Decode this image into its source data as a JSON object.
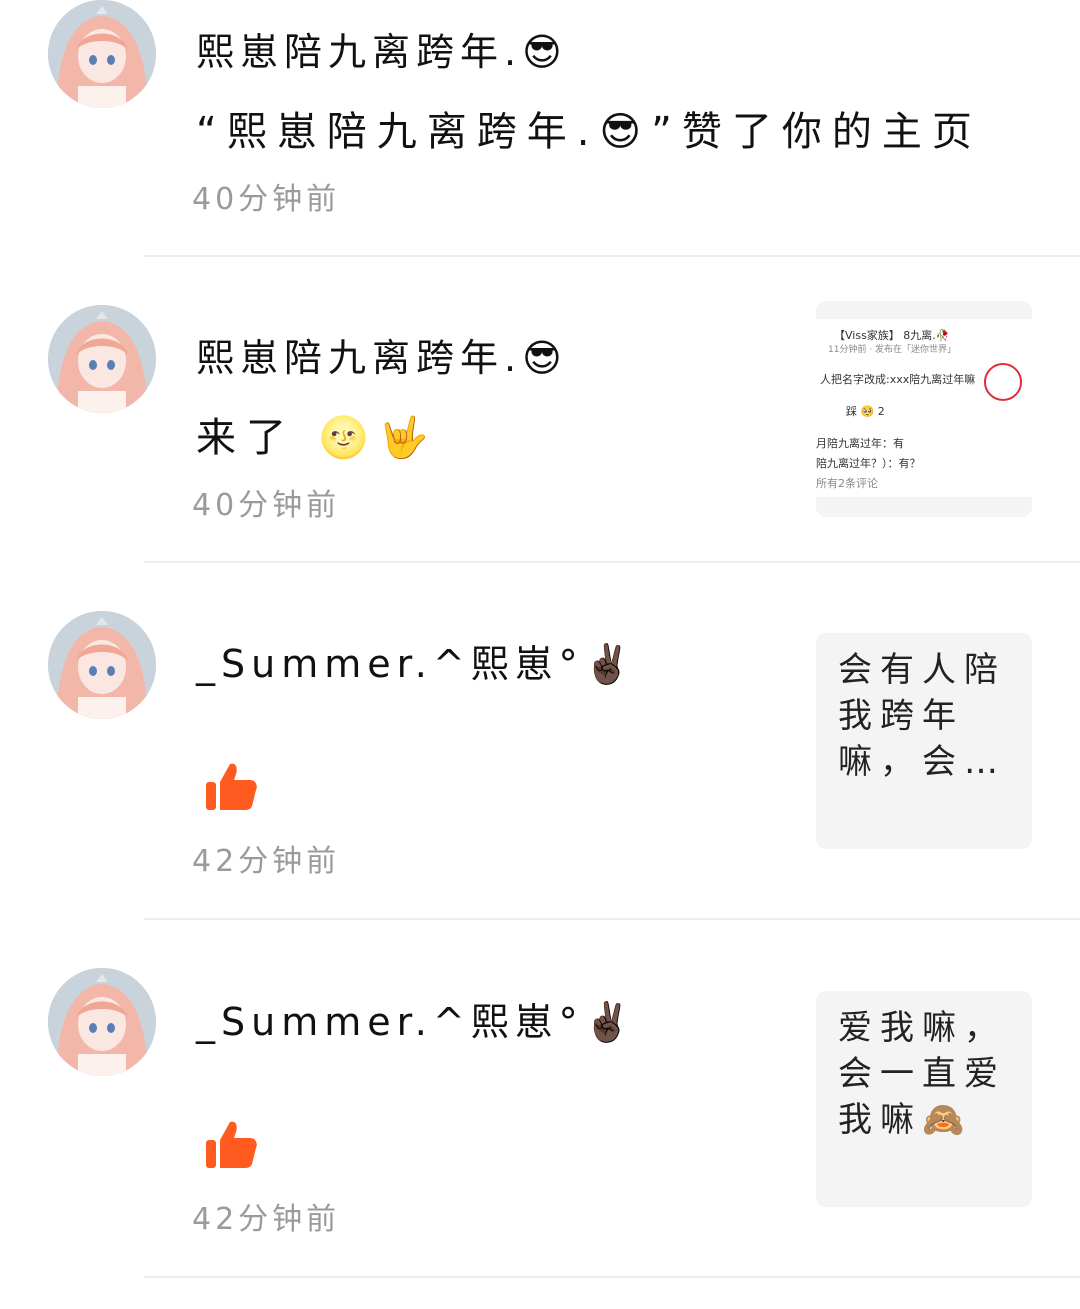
{
  "notifications": [
    {
      "user": "熙崽陪九离跨年.😎",
      "content": "“熙崽陪九离跨年.😎”赞了你的主页",
      "time": "40分钟前"
    },
    {
      "user": "熙崽陪九离跨年.😎",
      "content": "来了 🌝🤟",
      "time": "40分钟前",
      "thumbnail": {
        "header": "【Viss家族】 8九离.🥀",
        "subheader": "11分钟前 · 发布在「迷你世界」",
        "line1": "人把名字改成:xxx陪九离过年嘛",
        "reactions": "踩      🥺      2",
        "comment1": "月陪九离过年：有",
        "comment2": "陪九离过年？）：有？",
        "comment3": "所有2条评论"
      }
    },
    {
      "user": "_Summer.^熙崽°✌🏿",
      "time": "42分钟前",
      "preview": "会有人陪我跨年嘛，会…"
    },
    {
      "user": "_Summer.^熙崽°✌🏿",
      "time": "42分钟前",
      "preview": "爱我嘛，会一直爱我嘛🙈"
    }
  ],
  "colors": {
    "like": "#ff5a1f",
    "divider": "#eeeeee",
    "time": "#9a9a9a"
  },
  "icons": {
    "like": "thumbs-up-icon",
    "avatar": "anime-avatar"
  }
}
